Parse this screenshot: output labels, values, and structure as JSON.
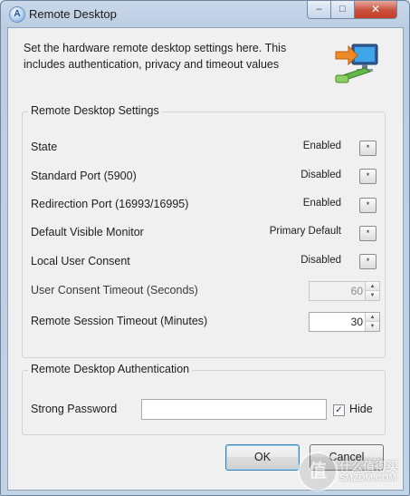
{
  "window": {
    "title": "Remote Desktop",
    "controls": {
      "minimize": "–",
      "maximize": "□",
      "close": "✕"
    }
  },
  "intro_text": "Set the hardware remote desktop settings here. This includes authentication, privacy and timeout values",
  "settings_group": {
    "legend": "Remote Desktop Settings",
    "rows": [
      {
        "label": "State",
        "value": "Enabled"
      },
      {
        "label": "Standard Port (5900)",
        "value": "Disabled"
      },
      {
        "label": "Redirection Port (16993/16995)",
        "value": "Enabled"
      },
      {
        "label": "Default Visible Monitor",
        "value": "Primary Default"
      },
      {
        "label": "Local User Consent",
        "value": "Disabled"
      }
    ],
    "select_glyph": "*",
    "user_consent_timeout": {
      "label": "User Consent Timeout (Seconds)",
      "value": "60",
      "enabled": false
    },
    "session_timeout": {
      "label": "Remote Session Timeout (Minutes)",
      "value": "30",
      "enabled": true
    }
  },
  "auth_group": {
    "legend": "Remote Desktop Authentication",
    "password_label": "Strong Password",
    "password_value": "",
    "hide_label": "Hide",
    "hide_checked": true,
    "check_glyph": "✓"
  },
  "buttons": {
    "ok": "OK",
    "cancel": "Cancel"
  },
  "watermark": {
    "logo": "值",
    "text": "什么值得买",
    "sub": "SMZDM.COM"
  }
}
